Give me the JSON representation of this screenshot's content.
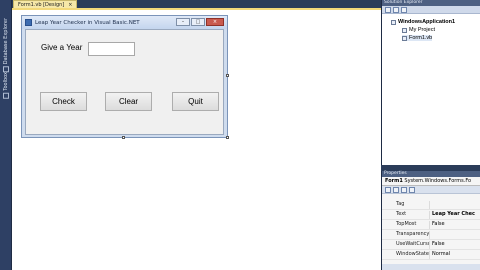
{
  "document_tab": {
    "title": "Form1.vb [Design]",
    "close_glyph": "×"
  },
  "left_strip": {
    "tabs": [
      "Database Explorer",
      "Toolbox"
    ]
  },
  "form": {
    "title": "Leap Year Checker in Visual Basic.NET",
    "label_give_year": "Give a Year",
    "year_value": "",
    "buttons": {
      "check": "Check",
      "clear": "Clear",
      "quit": "Quit"
    },
    "window_buttons": {
      "minimize": "–",
      "maximize": "□",
      "close": "×"
    }
  },
  "solution_explorer": {
    "title": "Solution Explorer",
    "items": [
      {
        "label": "WindowsApplication1",
        "icon": "solution-icon"
      },
      {
        "label": "My Project",
        "icon": "my-project-icon"
      },
      {
        "label": "Form1.vb",
        "icon": "form-file-icon"
      }
    ]
  },
  "properties": {
    "title": "Properties",
    "object": "Form1",
    "object_type": "System.Windows.Forms.Fo",
    "rows": [
      {
        "name": "Tag",
        "value": ""
      },
      {
        "name": "Text",
        "value": "Leap Year Chec",
        "bold": true
      },
      {
        "name": "TopMost",
        "value": "False"
      },
      {
        "name": "TransparencyK",
        "value": ""
      },
      {
        "name": "UseWaitCursor",
        "value": "False"
      },
      {
        "name": "WindowState",
        "value": "Normal"
      }
    ]
  },
  "colors": {
    "ide_background": "#2b3c59",
    "tab_active": "#f6e8a8",
    "close_button": "#c95a4e"
  }
}
